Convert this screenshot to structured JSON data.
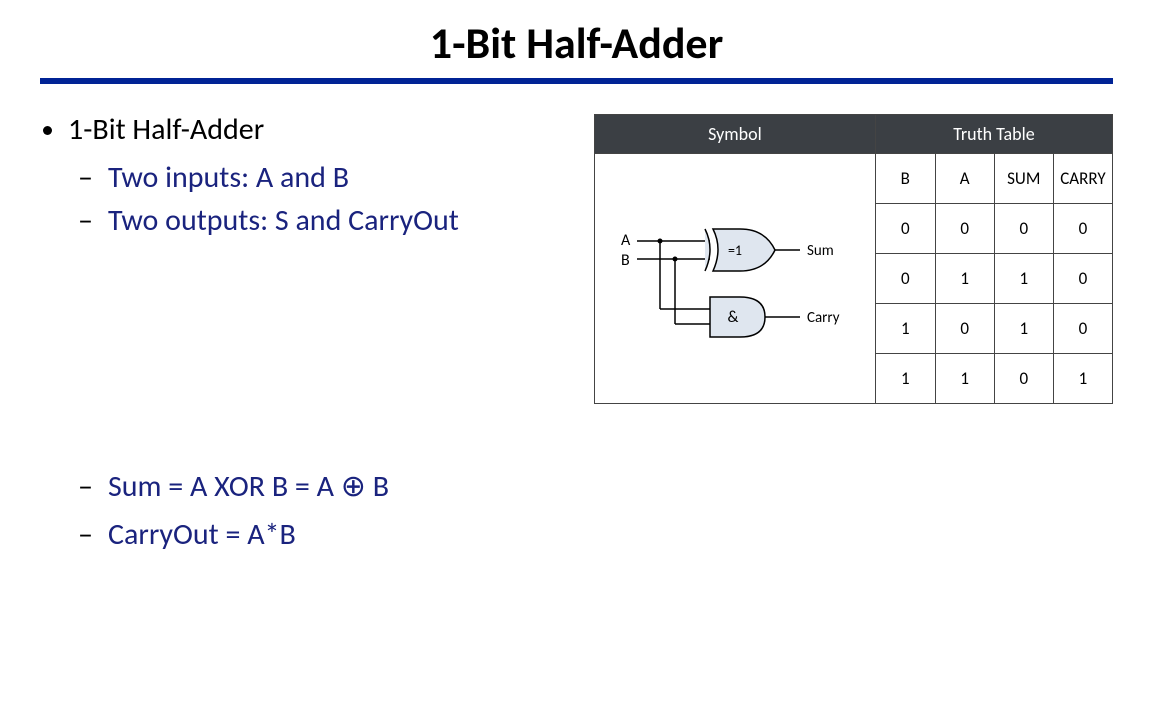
{
  "title": "1-Bit Half-Adder",
  "bullets": {
    "main": "1-Bit Half-Adder",
    "sub": [
      "Two inputs: A and B",
      "Two outputs: S and CarryOut"
    ],
    "equations": [
      "Sum = A XOR B = A ⊕ B",
      "CarryOut = A*B"
    ]
  },
  "symbol": {
    "header": "Symbol",
    "input_a": "A",
    "input_b": "B",
    "gate_xor": "=1",
    "gate_and": "&",
    "out_sum": "Sum",
    "out_carry": "Carry"
  },
  "truth": {
    "header": "Truth Table",
    "columns": [
      "B",
      "A",
      "SUM",
      "CARRY"
    ],
    "rows": [
      [
        "0",
        "0",
        "0",
        "0"
      ],
      [
        "0",
        "1",
        "1",
        "0"
      ],
      [
        "1",
        "0",
        "1",
        "0"
      ],
      [
        "1",
        "1",
        "0",
        "1"
      ]
    ]
  }
}
